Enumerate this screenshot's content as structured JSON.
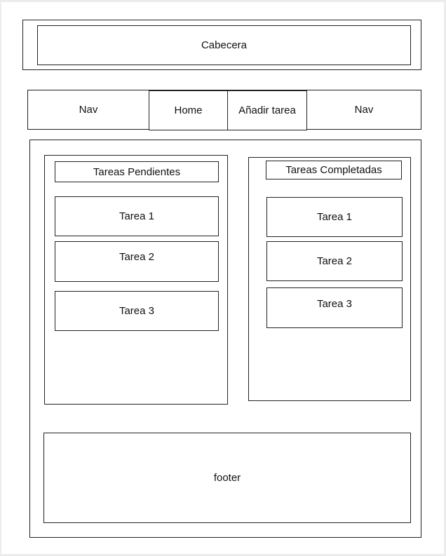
{
  "header": {
    "label": "Cabecera"
  },
  "nav": {
    "left_label": "Nav",
    "home_label": "Home",
    "add_task_label": "Añadir tarea",
    "right_label": "Nav"
  },
  "pending": {
    "title": "Tareas Pendientes",
    "tasks": [
      "Tarea 1",
      "Tarea 2",
      "Tarea 3"
    ]
  },
  "completed": {
    "title": "Tareas Completadas",
    "tasks": [
      "Tarea 1",
      "Tarea 2",
      "Tarea 3"
    ]
  },
  "footer": {
    "label": "footer"
  }
}
